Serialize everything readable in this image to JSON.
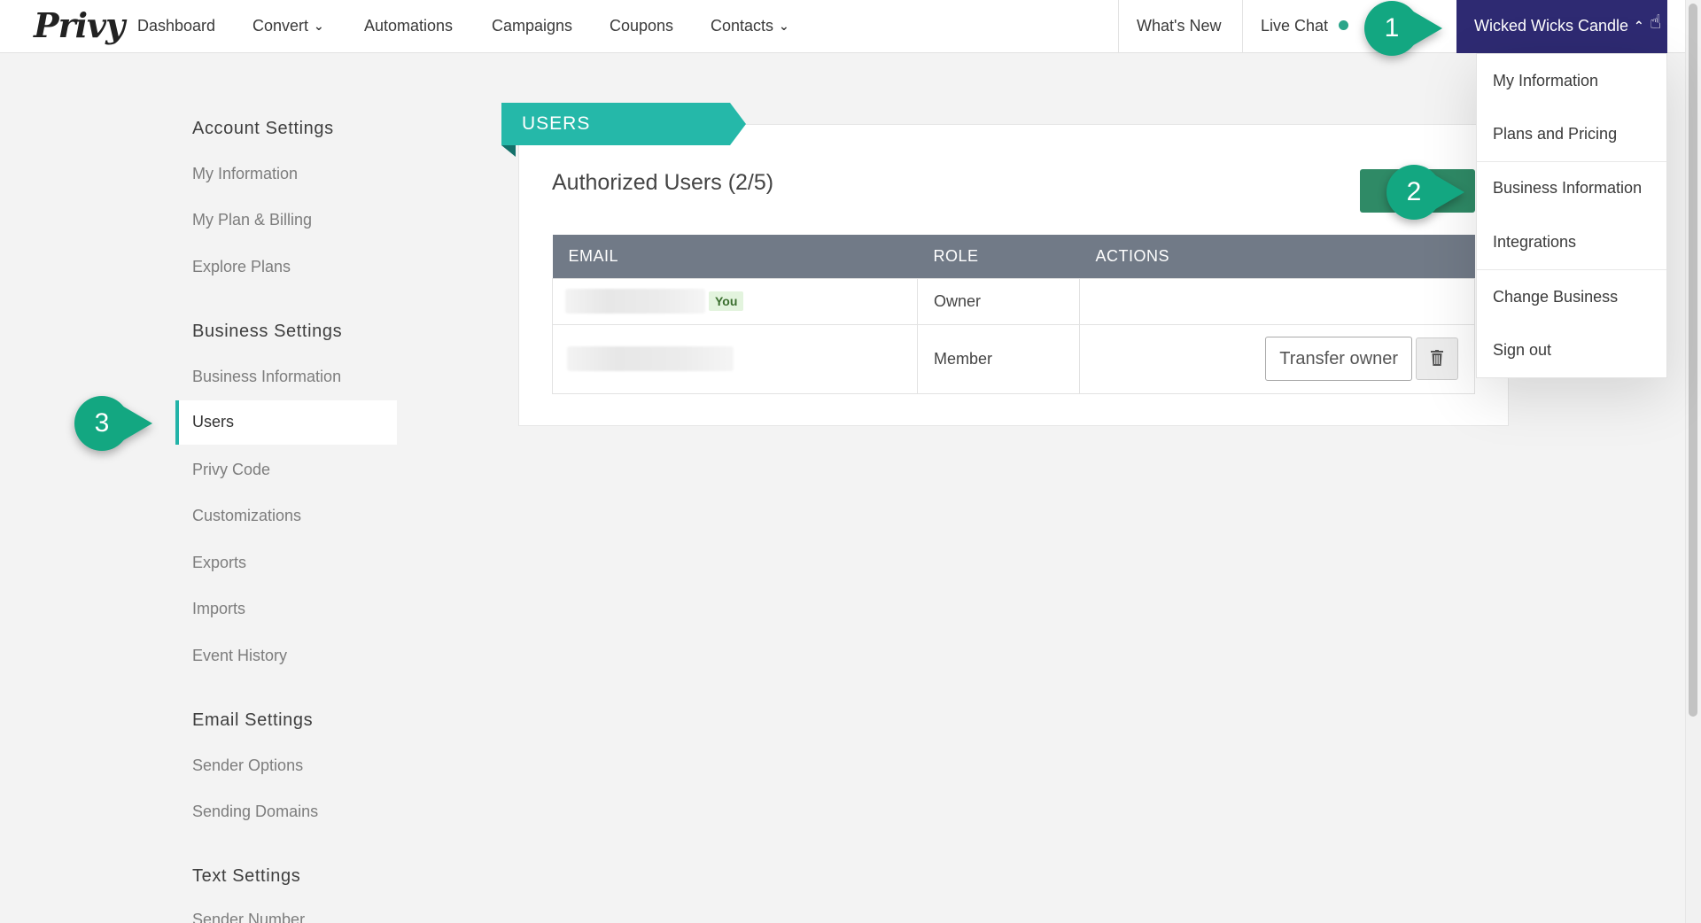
{
  "app": {
    "logo_text": "Privy"
  },
  "nav": {
    "items": [
      "Dashboard",
      "Convert",
      "Automations",
      "Campaigns",
      "Coupons",
      "Contacts"
    ],
    "whats_new": "What's New",
    "live_chat": "Live Chat",
    "business_name": "Wicked Wicks Candle",
    "status_color": "#2aa58a",
    "brand_color": "#2e2a72"
  },
  "sidebar": {
    "sections": [
      {
        "title": "Account Settings",
        "items": [
          "My Information",
          "My Plan & Billing",
          "Explore Plans"
        ]
      },
      {
        "title": "Business Settings",
        "items": [
          "Business Information",
          "Users",
          "Privy Code",
          "Customizations",
          "Exports",
          "Imports",
          "Event History"
        ]
      },
      {
        "title": "Email Settings",
        "items": [
          "Sender Options",
          "Sending Domains"
        ]
      },
      {
        "title": "Text Settings",
        "items": [
          "Sender Number"
        ]
      }
    ],
    "active_item": "Users",
    "accent_color": "#22b3a8"
  },
  "main": {
    "ribbon": "USERS",
    "title": "Authorized Users (2/5)",
    "table": {
      "headers": [
        "EMAIL",
        "ROLE",
        "ACTIONS"
      ],
      "rows": [
        {
          "role": "Owner",
          "badge": "You"
        },
        {
          "role": "Member",
          "action": "Transfer owner"
        }
      ]
    }
  },
  "dropdown": {
    "items": [
      "My Information",
      "Plans and Pricing",
      "Business Information",
      "Integrations",
      "Change Business",
      "Sign out"
    ]
  },
  "callouts": [
    "1",
    "2",
    "3"
  ],
  "icons": {
    "chevron": "chevron-down-icon",
    "trash": "trash-icon",
    "cursor": "hand-pointer-icon"
  }
}
